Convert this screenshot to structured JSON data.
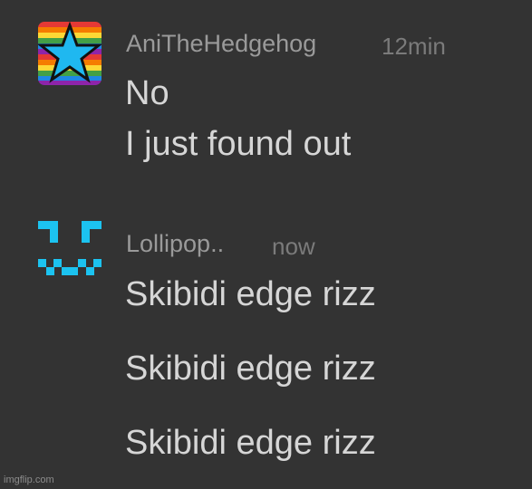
{
  "messages": [
    {
      "username": "AniTheHedgehog",
      "time": "12min",
      "avatar_icon": "rainbow-star-icon",
      "lines": [
        "No",
        "I just found out"
      ]
    },
    {
      "username": "Lollipop..",
      "time": "now",
      "avatar_icon": "pixel-face-icon",
      "lines": [
        "Skibidi edge rizz",
        "Skibidi edge rizz",
        "Skibidi edge rizz"
      ]
    }
  ],
  "colors": {
    "background": "#333333",
    "message_text": "#d6d6d6",
    "username_text": "#9a9a9a",
    "time_text": "#7b7b7b",
    "star_fill": "#1fb8f0",
    "pixel_face": "#1cc3f0"
  },
  "watermark": "imgflip.com"
}
